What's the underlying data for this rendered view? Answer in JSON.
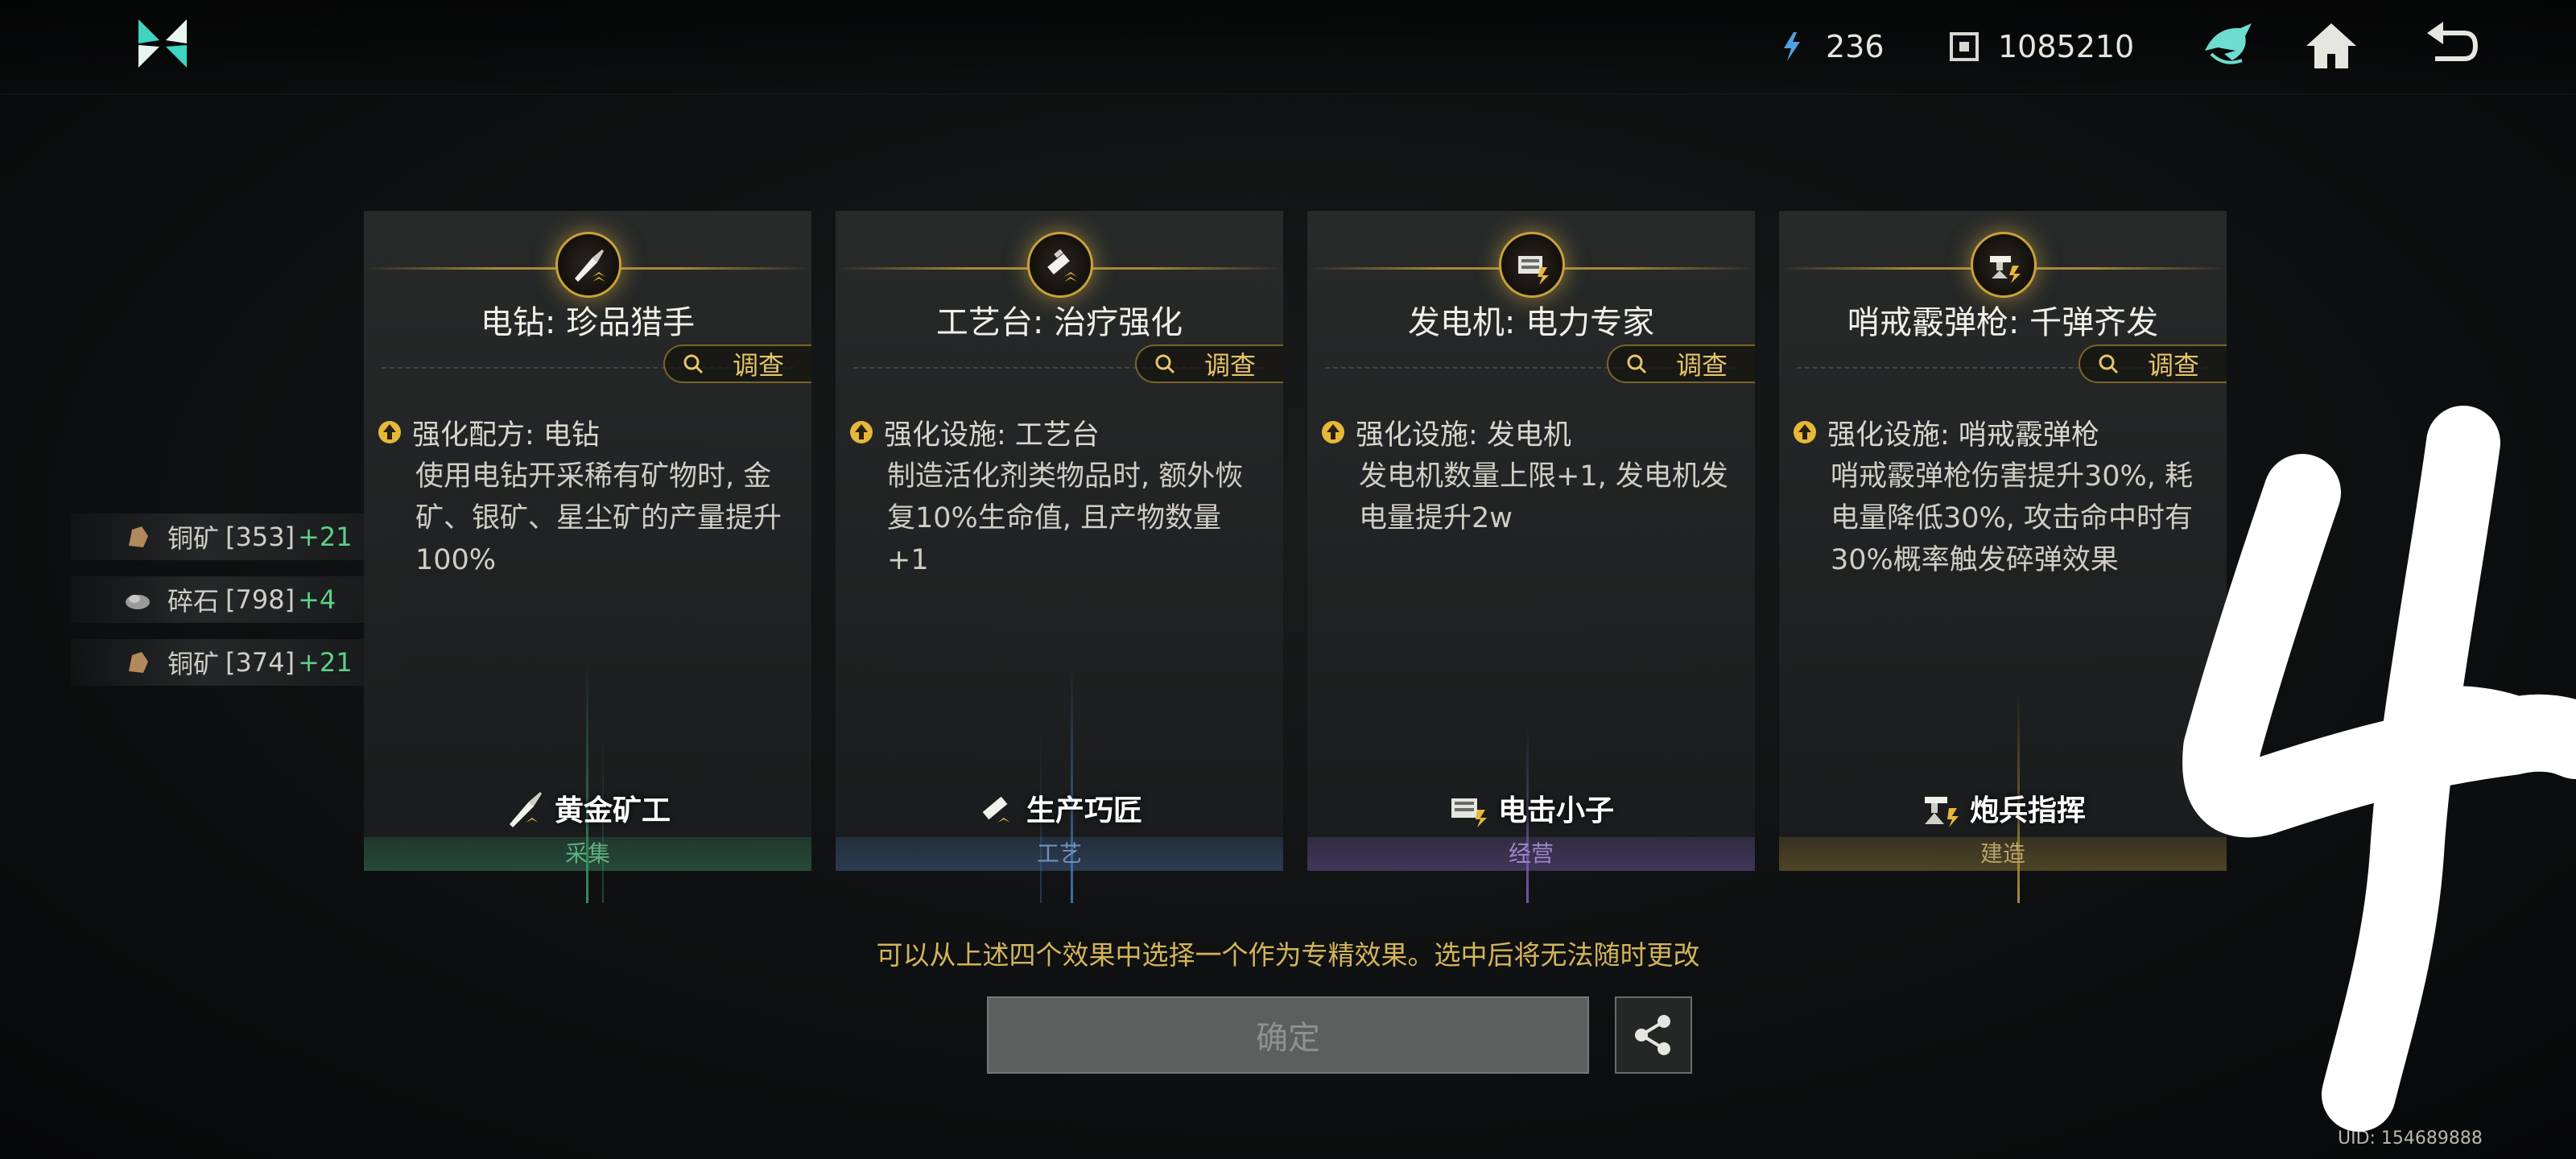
{
  "topbar": {
    "energy": "236",
    "coins": "1085210",
    "nav_icons": [
      "wolf-emblem-icon",
      "home-icon",
      "back-arrow-icon"
    ]
  },
  "materials": [
    {
      "name": "铜矿",
      "count": "[353]",
      "plus": "+21",
      "icon": "copper-ore-icon"
    },
    {
      "name": "碎石",
      "count": "[798]",
      "plus": "+4",
      "icon": "gravel-icon"
    },
    {
      "name": "铜矿",
      "count": "[374]",
      "plus": "+21",
      "icon": "copper-ore-icon"
    }
  ],
  "investigate_label": "调查",
  "cards": [
    {
      "title": "电钻: 珍品猎手",
      "effect_head": "强化配方: 电钻",
      "effect_desc": "使用电钻开采稀有矿物时, 金矿、银矿、星尘矿的产量提升100%",
      "trait": "黄金矿工",
      "category": "采集",
      "icon": "drill-icon",
      "accent": "#3fae74"
    },
    {
      "title": "工艺台: 治疗强化",
      "effect_head": "强化设施: 工艺台",
      "effect_desc": "制造活化剂类物品时, 额外恢复10%生命值, 且产物数量+1",
      "trait": "生产巧匠",
      "category": "工艺",
      "icon": "workbench-icon",
      "accent": "#4f7fc0"
    },
    {
      "title": "发电机: 电力专家",
      "effect_head": "强化设施: 发电机",
      "effect_desc": "发电机数量上限+1, 发电机发电量提升2w",
      "trait": "电击小子",
      "category": "经营",
      "icon": "generator-icon",
      "accent": "#8a6ad0"
    },
    {
      "title": "哨戒霰弹枪: 千弹齐发",
      "effect_head": "强化设施: 哨戒霰弹枪",
      "effect_desc": "哨戒霰弹枪伤害提升30%, 耗电量降低30%, 攻击命中时有30%概率触发碎弹效果",
      "trait": "炮兵指挥",
      "category": "建造",
      "icon": "turret-icon",
      "accent": "#c9a23a"
    }
  ],
  "hint": "可以从上述四个效果中选择一个作为专精效果。选中后将无法随时更改",
  "confirm_label": "确定",
  "uid": "UID: 154689888",
  "overlay_scribble": "4"
}
